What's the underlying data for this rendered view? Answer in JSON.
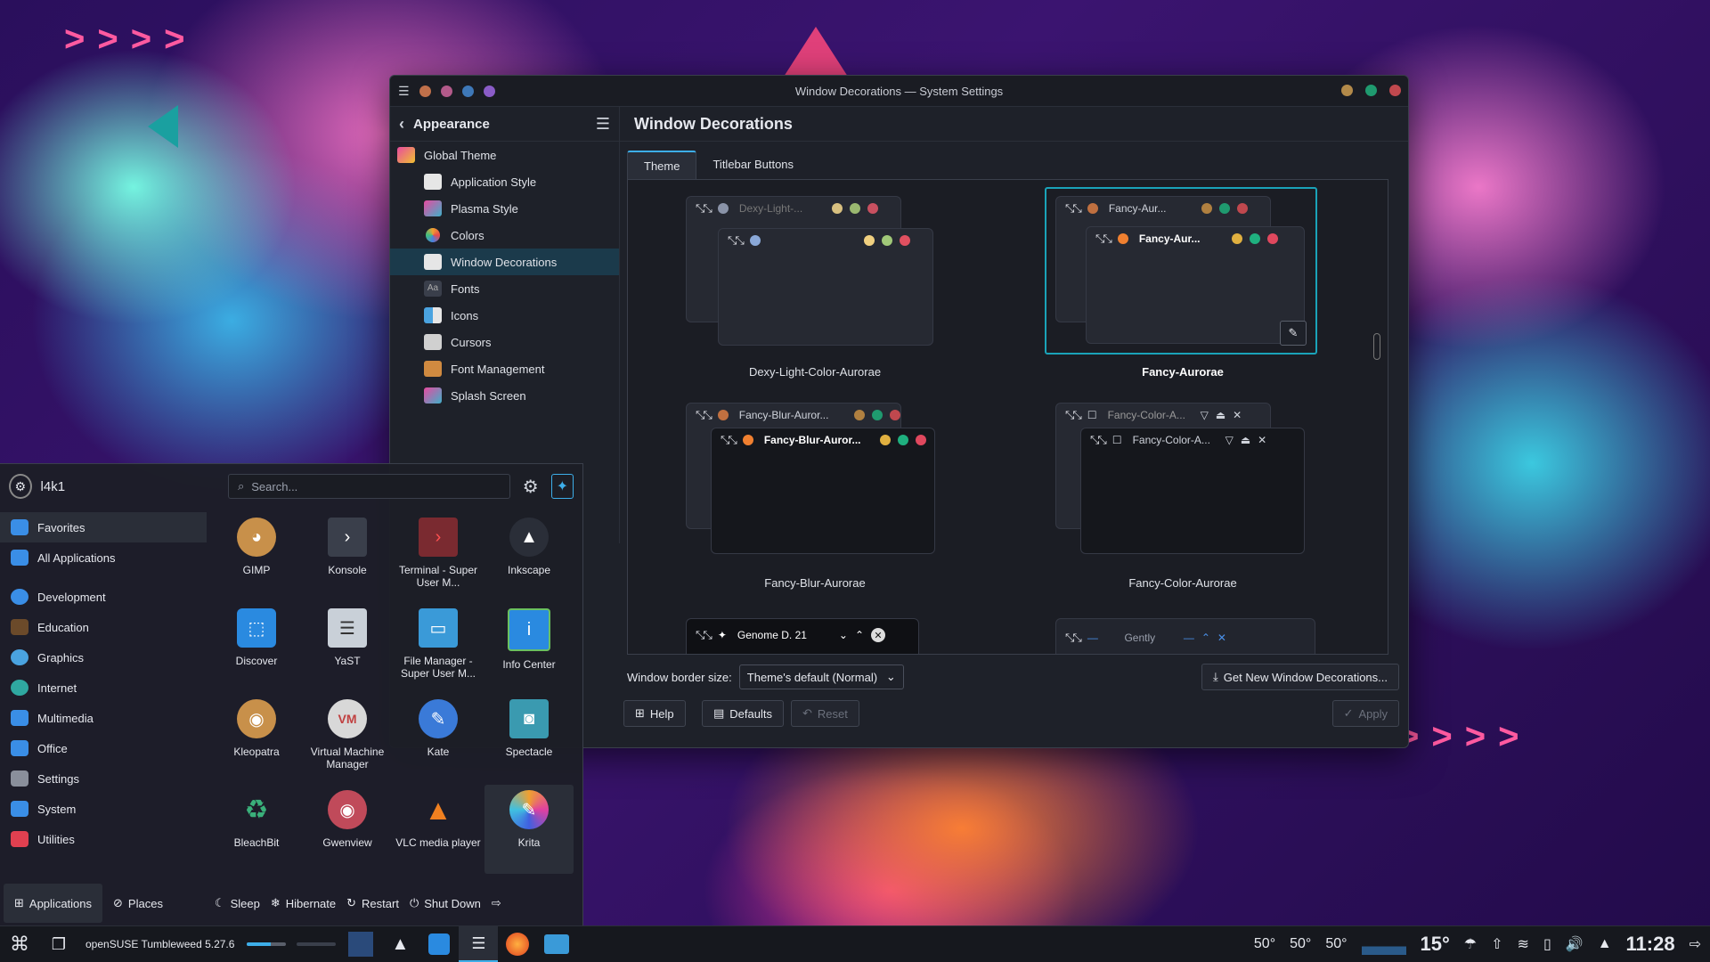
{
  "window": {
    "title": "Window Decorations — System Settings",
    "left_dots": [
      "#c0704a",
      "#b35a8a",
      "#3e78b8",
      "#8a5cc7"
    ],
    "right_dots": [
      "#b38a4a",
      "#1f9a6f",
      "#c0484e"
    ]
  },
  "sidebar": {
    "header": "Appearance",
    "items": [
      {
        "label": "Global Theme",
        "color": "#e84aa0"
      },
      {
        "label": "Application Style",
        "color": "#e6e6e6"
      },
      {
        "label": "Plasma Style",
        "color": "#3fb0c9"
      },
      {
        "label": "Colors",
        "color": "#f0a030"
      },
      {
        "label": "Window Decorations",
        "color": "#e6e6e6"
      },
      {
        "label": "Fonts",
        "color": "#5a5f6b"
      },
      {
        "label": "Icons",
        "color": "#4aa3e0"
      },
      {
        "label": "Cursors",
        "color": "#d0d0d0"
      },
      {
        "label": "Font Management",
        "color": "#d08a40"
      },
      {
        "label": "Splash Screen",
        "color": "#3fb0c9"
      }
    ]
  },
  "content": {
    "title": "Window Decorations",
    "tabs": [
      "Theme",
      "Titlebar Buttons"
    ],
    "themes": [
      {
        "label": "Dexy-Light-Color-Aurorae",
        "back_name": "Dexy-Light-...",
        "front_name": ""
      },
      {
        "label": "Fancy-Aurorae",
        "back_name": "Fancy-Aur...",
        "front_name": "Fancy-Aur..."
      },
      {
        "label": "Fancy-Blur-Aurorae",
        "back_name": "Fancy-Blur-Auror...",
        "front_name": "Fancy-Blur-Auror..."
      },
      {
        "label": "Fancy-Color-Aurorae",
        "back_name": "Fancy-Color-A...",
        "front_name": "Fancy-Color-A..."
      }
    ],
    "partial_themes": [
      "Genome D. 21",
      "Gently"
    ],
    "border_label": "Window border size:",
    "border_value": "Theme's default (Normal)",
    "get_new": "Get New Window Decorations...",
    "help": "Help",
    "defaults": "Defaults",
    "reset": "Reset",
    "apply": "Apply"
  },
  "menu": {
    "user": "l4k1",
    "search_placeholder": "Search...",
    "categories": [
      {
        "label": "Favorites",
        "color": "#3a8ee6"
      },
      {
        "label": "All Applications",
        "color": "#3a8ee6"
      },
      {
        "label": "Development",
        "color": "#3a8ee6"
      },
      {
        "label": "Education",
        "color": "#6b4a2a"
      },
      {
        "label": "Graphics",
        "color": "#4aa3e0"
      },
      {
        "label": "Internet",
        "color": "#2fa8a0"
      },
      {
        "label": "Multimedia",
        "color": "#3a8ee6"
      },
      {
        "label": "Office",
        "color": "#3a8ee6"
      },
      {
        "label": "Settings",
        "color": "#8a8f9b"
      },
      {
        "label": "System",
        "color": "#3a8ee6"
      },
      {
        "label": "Utilities",
        "color": "#e04050"
      }
    ],
    "apps": [
      {
        "label": "GIMP",
        "color": "#c8904a",
        "glyph": "◕"
      },
      {
        "label": "Konsole",
        "color": "#3a3f4b",
        "glyph": "›"
      },
      {
        "label": "Terminal - Super User M...",
        "color": "#7a2a30",
        "glyph": "›"
      },
      {
        "label": "Inkscape",
        "color": "#2a2e38",
        "glyph": "▲"
      },
      {
        "label": "Discover",
        "color": "#2a8ae0",
        "glyph": "⬚"
      },
      {
        "label": "YaST",
        "color": "#c9d0d8",
        "glyph": "☰"
      },
      {
        "label": "File Manager - Super User M...",
        "color": "#3a9ad8",
        "glyph": "▭"
      },
      {
        "label": "Info Center",
        "color": "#2a8ae0",
        "glyph": "i"
      },
      {
        "label": "Kleopatra",
        "color": "#c8904a",
        "glyph": "◉"
      },
      {
        "label": "Virtual Machine Manager",
        "color": "#d8d8d8",
        "glyph": "VM"
      },
      {
        "label": "Kate",
        "color": "#3a7ad8",
        "glyph": "✎"
      },
      {
        "label": "Spectacle",
        "color": "#3a9ab0",
        "glyph": "◙"
      },
      {
        "label": "BleachBit",
        "color": "#2a8a5a",
        "glyph": "♻"
      },
      {
        "label": "Gwenview",
        "color": "#c04a5a",
        "glyph": "◉"
      },
      {
        "label": "VLC media player",
        "color": "#f08020",
        "glyph": "▲"
      },
      {
        "label": "Krita",
        "color": "#c040d0",
        "glyph": "✎"
      }
    ],
    "footer": [
      "Applications",
      "Places",
      "Sleep",
      "Hibernate",
      "Restart",
      "Shut Down"
    ]
  },
  "taskbar": {
    "os_label": "openSUSE Tumbleweed 5.27.6",
    "temps": [
      "50°",
      "50°",
      "50°"
    ],
    "weather": "15°",
    "clock": "11:28"
  }
}
